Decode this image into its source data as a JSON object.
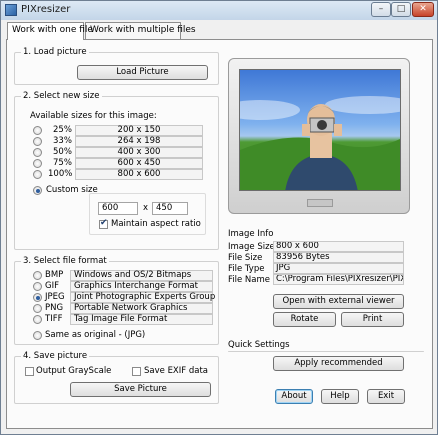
{
  "window": {
    "title": "PIXresizer"
  },
  "title_buttons": {
    "minimize": "–",
    "maximize": "□",
    "close": "✕"
  },
  "tabs": [
    "Work with one file",
    "Work with multiple files"
  ],
  "load": {
    "title": "1. Load picture",
    "button": "Load Picture"
  },
  "new_size": {
    "title": "2. Select new size",
    "available_label": "Available sizes for this image:",
    "options": [
      {
        "percent": "25%",
        "dims": "200 x 150"
      },
      {
        "percent": "33%",
        "dims": "264 x 198"
      },
      {
        "percent": "50%",
        "dims": "400 x 300"
      },
      {
        "percent": "75%",
        "dims": "600 x 450"
      },
      {
        "percent": "100%",
        "dims": "800 x 600"
      }
    ],
    "custom_label": "Custom size",
    "width": "600",
    "x_sep": "x",
    "height": "450",
    "aspect_label": "Maintain aspect ratio"
  },
  "file_format": {
    "title": "3. Select file format",
    "options": [
      {
        "ext": "BMP",
        "desc": "Windows and OS/2 Bitmaps"
      },
      {
        "ext": "GIF",
        "desc": "Graphics Interchange Format"
      },
      {
        "ext": "JPEG",
        "desc": "Joint Photographic Experts Group"
      },
      {
        "ext": "PNG",
        "desc": "Portable Network Graphics"
      },
      {
        "ext": "TIFF",
        "desc": "Tag Image File Format"
      }
    ],
    "same_as_original": "Same as original  - (JPG)"
  },
  "save": {
    "title": "4. Save picture",
    "grayscale": "Output GrayScale",
    "exif": "Save EXIF data",
    "button": "Save Picture"
  },
  "image_info": {
    "title": "Image Info",
    "rows": [
      {
        "label": "Image Size",
        "value": "800 x 600"
      },
      {
        "label": "File Size",
        "value": "83956 Bytes"
      },
      {
        "label": "File Type",
        "value": "JPG"
      },
      {
        "label": "File Name",
        "value": "C:\\Program Files\\PIXresizer\\PIXresiz"
      }
    ]
  },
  "actions": {
    "open_external": "Open with external viewer",
    "rotate": "Rotate",
    "print": "Print"
  },
  "quick": {
    "title": "Quick Settings",
    "apply": "Apply recommended"
  },
  "footer": {
    "about": "About",
    "help": "Help",
    "exit": "Exit"
  }
}
